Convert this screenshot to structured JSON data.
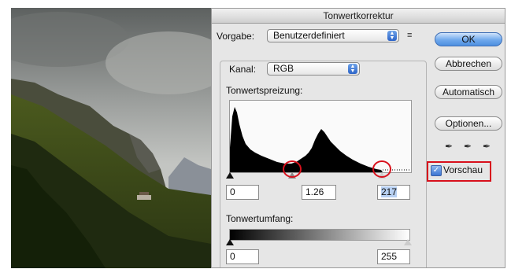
{
  "dialog": {
    "title": "Tonwertkorrektur",
    "preset_label": "Vorgabe:",
    "preset_value": "Benutzerdefiniert",
    "channel_label": "Kanal:",
    "channel_value": "RGB",
    "input_levels_label": "Tonwertspreizung:",
    "input_black": "0",
    "input_gamma": "1.26",
    "input_white": "217",
    "output_levels_label": "Tonwertumfang:",
    "output_black": "0",
    "output_white": "255"
  },
  "buttons": {
    "ok": "OK",
    "cancel": "Abbrechen",
    "auto": "Automatisch",
    "options": "Optionen..."
  },
  "preview": {
    "label": "Vorschau",
    "checked": true
  },
  "icons": {
    "preset_menu": "preset-options-icon",
    "popup_arrows": "popup-arrows-icon",
    "droppers": [
      "black-point-eyedropper-icon",
      "gray-point-eyedropper-icon",
      "white-point-eyedropper-icon"
    ]
  },
  "colors": {
    "ok_button": "#5b9ae6",
    "highlight": "#d8101c",
    "selection": "#b7d0f2"
  }
}
